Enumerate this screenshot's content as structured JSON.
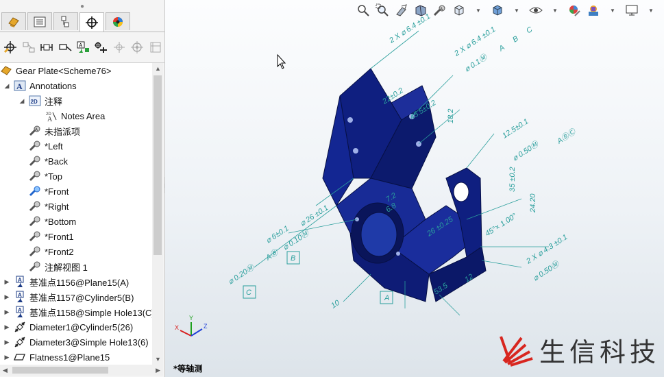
{
  "tree": {
    "root": "Gear Plate<Scheme76>",
    "items": [
      {
        "label": "Annotations"
      },
      {
        "label": "注释"
      },
      {
        "label": "Notes Area"
      },
      {
        "label": "未指派项"
      },
      {
        "label": "*Left"
      },
      {
        "label": "*Back"
      },
      {
        "label": "*Top"
      },
      {
        "label": "*Front"
      },
      {
        "label": "*Right"
      },
      {
        "label": "*Bottom"
      },
      {
        "label": "*Front1"
      },
      {
        "label": "*Front2"
      },
      {
        "label": "注解视图 1"
      },
      {
        "label": "基准点1156@Plane15(A)"
      },
      {
        "label": "基准点1157@Cylinder5(B)"
      },
      {
        "label": "基准点1158@Simple Hole13(C)"
      },
      {
        "label": "Diameter1@Cylinder5(26)"
      },
      {
        "label": "Diameter3@Simple Hole13(6)"
      },
      {
        "label": "Flatness1@Plane15"
      }
    ]
  },
  "tabs": [
    "feature-manager",
    "property-manager",
    "configuration-manager",
    "dimxpert-manager",
    "display-manager"
  ],
  "dimxpert_tools": [
    "auto-dimension-scheme",
    "show-tolerance-status",
    "location-dimension",
    "size-dimension",
    "datum",
    "geometric-tolerance",
    "copy-scheme",
    "tcc-pattern",
    "delete-all"
  ],
  "view_toolbar": [
    "zoom-to-fit",
    "zoom-to-area",
    "previous-view",
    "section-view",
    "dynamic-annotation-views",
    "view-orientation",
    "display-style",
    "hide-show-items",
    "edit-appearance",
    "apply-scene",
    "view-settings",
    "display-monitor"
  ],
  "viewport": {
    "view_name": "*等轴测",
    "annotations": {
      "t1": "2 X ⌀ 6.4 ±0.1",
      "t2": "2 X ⌀ 6.4 ±0.1",
      "t3": "⌀ 0.1Ⓜ",
      "t4": "A",
      "t5": "B",
      "t6": "C",
      "t7": "45.5±0.2",
      "t8": "22±0.2",
      "t9": "18.2",
      "t10": "12.5±0.1",
      "t11": "⌀ 0.50Ⓜ",
      "t12": "AⒷⒸ",
      "t13": "35 ±0.2",
      "t14": "24.20",
      "t15": "⌀ 26 ±0.1",
      "t16": "⌀ 6±0.1",
      "t17": "⌀ 0.10Ⓜ",
      "t18": "AⒷ",
      "t19": "⌀ 0.20Ⓜ",
      "t20": "7.2",
      "t21": "6.8",
      "t22": "45°× 1.00°",
      "t23": "2 X ⌀ 4.3 ±0.1",
      "t24": "⌀ 0.50Ⓜ",
      "t25": "53.5",
      "t26": "12",
      "t27": "10",
      "t28": "A",
      "t29": "B",
      "t30": "C",
      "t31": "26 ±0.25"
    },
    "triad": {
      "x": "X",
      "y": "Y",
      "z": "Z"
    }
  },
  "logo_text": "生信科技",
  "colors": {
    "part": "#1b2d8c",
    "annotation": "#2a9f9c",
    "selection": "#cde8ff"
  }
}
